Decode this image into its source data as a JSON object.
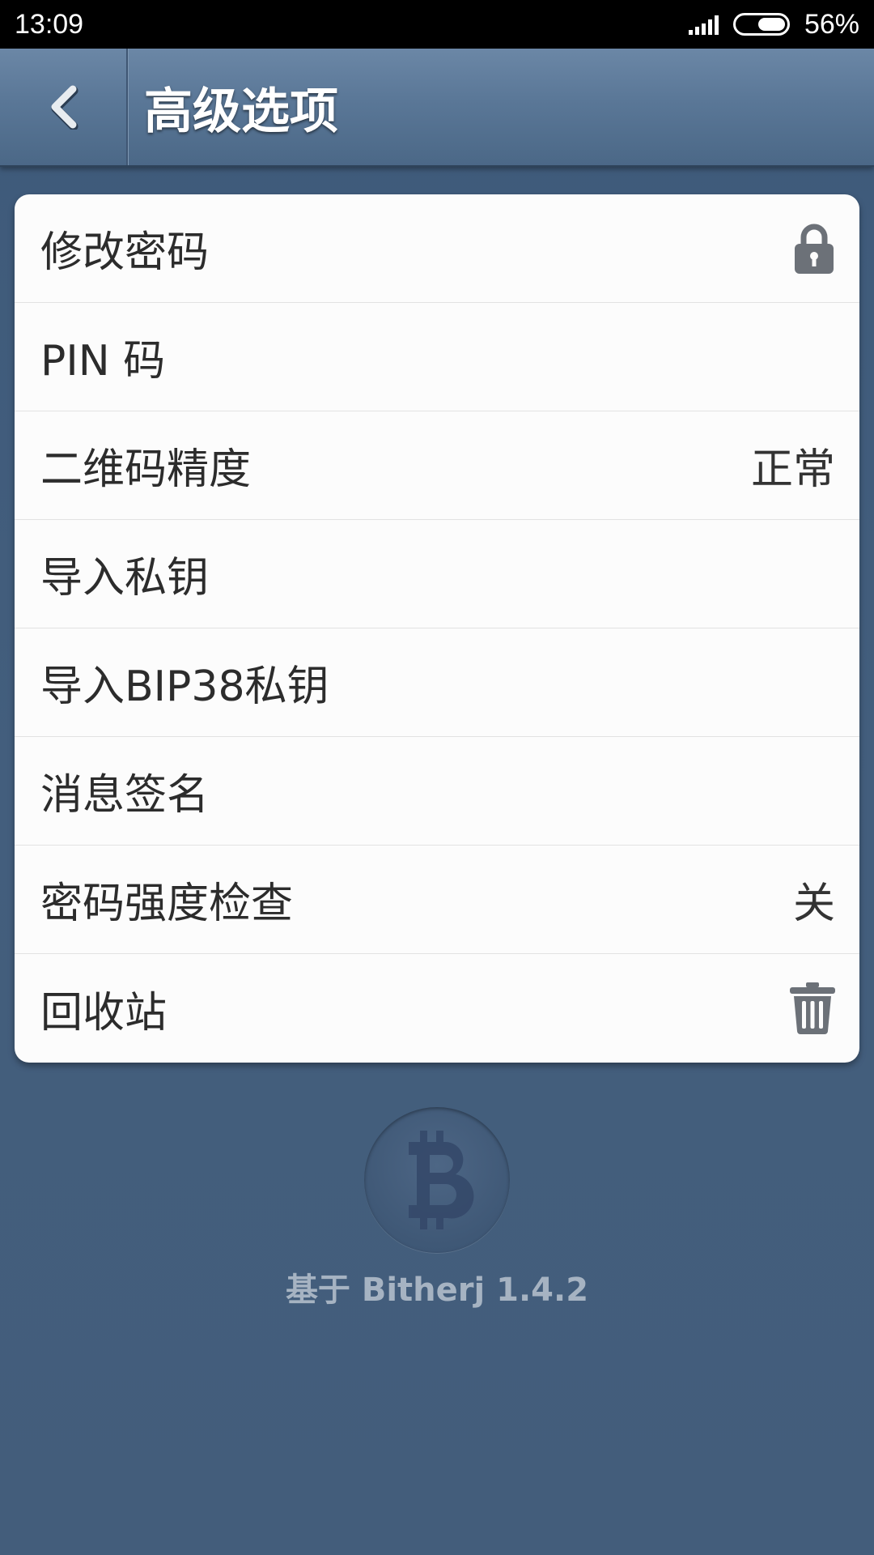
{
  "status_bar": {
    "time": "13:09",
    "battery_percent": "56%",
    "battery_level": 0.56
  },
  "header": {
    "title": "高级选项",
    "back_icon": "chevron-left-icon"
  },
  "settings": {
    "items": [
      {
        "label": "修改密码",
        "value": "",
        "icon": "lock-icon"
      },
      {
        "label": "PIN 码",
        "value": "",
        "icon": ""
      },
      {
        "label": "二维码精度",
        "value": "正常",
        "icon": ""
      },
      {
        "label": "导入私钥",
        "value": "",
        "icon": ""
      },
      {
        "label": "导入BIP38私钥",
        "value": "",
        "icon": ""
      },
      {
        "label": "消息签名",
        "value": "",
        "icon": ""
      },
      {
        "label": "密码强度检查",
        "value": "关",
        "icon": ""
      },
      {
        "label": "回收站",
        "value": "",
        "icon": "trash-icon"
      }
    ]
  },
  "footer": {
    "logo_icon": "bitcoin-icon",
    "version_text": "基于 Bitherj 1.4.2"
  },
  "colors": {
    "background": "#435e7d",
    "actionbar": "#5a7797",
    "card": "#fcfcfc",
    "icon_gray": "#6c7178"
  }
}
